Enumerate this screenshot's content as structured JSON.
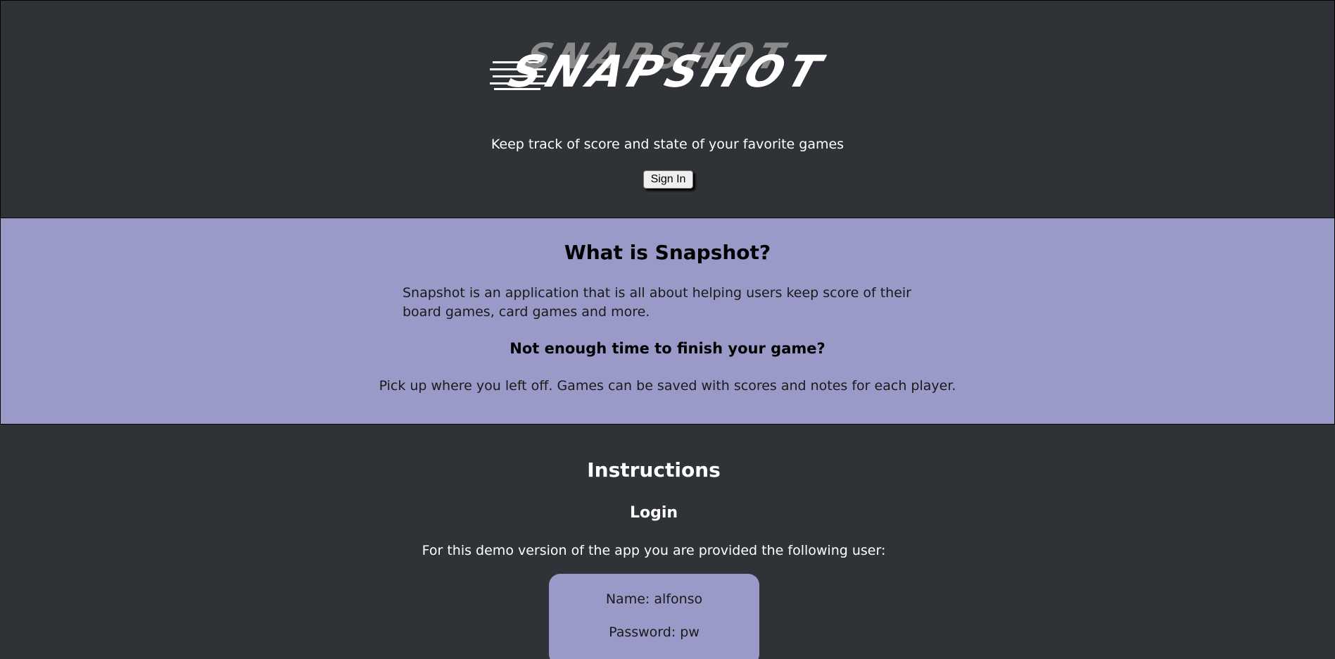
{
  "header": {
    "logo_text": "SNAPSHOT",
    "tagline": "Keep track of score and state of your favorite games",
    "sign_in_label": "Sign In"
  },
  "about": {
    "title": "What is Snapshot?",
    "description": "Snapshot is an application that is all about helping users keep score of their board games, card games and more.",
    "subtitle": "Not enough time to finish your game?",
    "pickup_text": "Pick up where you left off. Games can be saved with scores and notes for each player."
  },
  "instructions": {
    "title": "Instructions",
    "login_heading": "Login",
    "demo_text": "For this demo version of the app you are provided the following user:",
    "name_line": "Name: alfonso",
    "password_line": "Password: pw"
  },
  "colors": {
    "dark_background": "#2f3338",
    "section_purple": "#9a9ac8",
    "text_light": "#ffffff"
  }
}
